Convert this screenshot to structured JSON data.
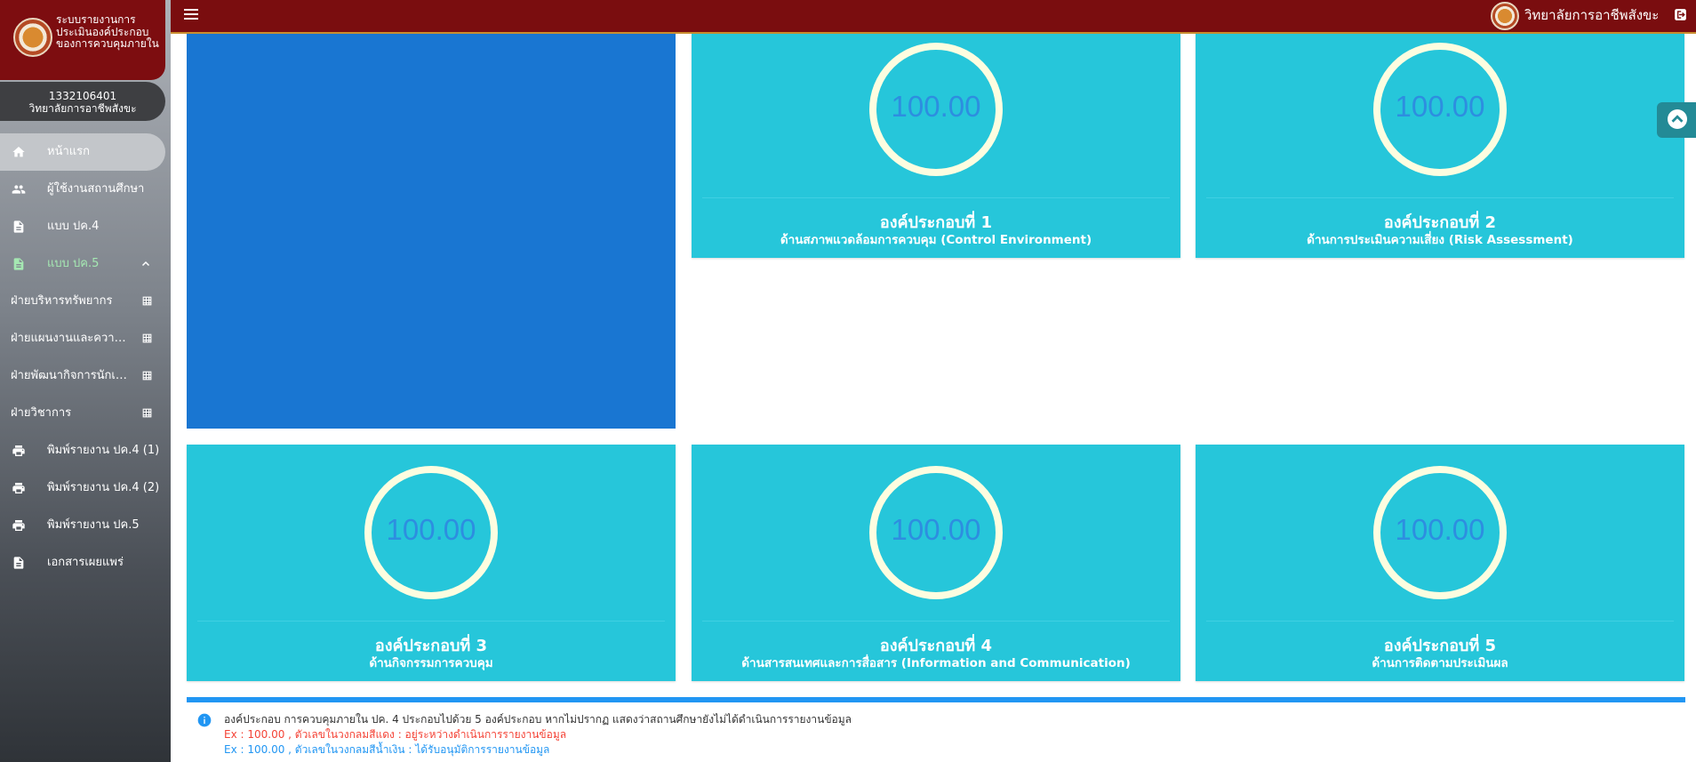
{
  "sidebar": {
    "brand_title": "ระบบรายงานการประเมินองค์ประกอบของการควบคุมภายใน",
    "school_code": "1332106401",
    "school_name": "วิทยาลัยการอาชีพสังขะ",
    "nav": [
      {
        "label": "หน้าแรก",
        "icon": "home-icon",
        "active": true
      },
      {
        "label": "ผู้ใช้งานสถานศึกษา",
        "icon": "users-icon"
      },
      {
        "label": "แบบ ปค.4",
        "icon": "document-icon"
      },
      {
        "label": "แบบ ปค.5",
        "icon": "document-icon",
        "open": true
      }
    ],
    "sub_items": [
      {
        "label": "ฝ่ายบริหารทรัพยากร"
      },
      {
        "label": "ฝ่ายแผนงานและความร่วมมือ"
      },
      {
        "label": "ฝ่ายพัฒนากิจการนักเรียนนักศึกษา"
      },
      {
        "label": "ฝ่ายวิชาการ"
      }
    ],
    "nav_bottom": [
      {
        "label": "พิมพ์รายงาน ปค.4 (1)",
        "icon": "printer-icon"
      },
      {
        "label": "พิมพ์รายงาน ปค.4 (2)",
        "icon": "printer-icon"
      },
      {
        "label": "พิมพ์รายงาน ปค.5",
        "icon": "printer-icon"
      },
      {
        "label": "เอกสารเผยแพร่",
        "icon": "document-icon"
      }
    ]
  },
  "topbar": {
    "school_name": "วิทยาลัยการอาชีพสังขะ"
  },
  "cards": [
    {
      "score": "100.00",
      "title": "องค์ประกอบที่ 1",
      "subtitle": "ด้านสภาพแวดล้อมการควบคุม (Control Environment)"
    },
    {
      "score": "100.00",
      "title": "องค์ประกอบที่ 2",
      "subtitle": "ด้านการประเมินความเสี่ยง (Risk Assessment)"
    },
    {
      "score": "100.00",
      "title": "องค์ประกอบที่ 3",
      "subtitle": "ด้านกิจกรรมการควบคุม"
    },
    {
      "score": "100.00",
      "title": "องค์ประกอบที่ 4",
      "subtitle": "ด้านสารสนเทศและการสื่อสาร (Information and Communication)"
    },
    {
      "score": "100.00",
      "title": "องค์ประกอบที่ 5",
      "subtitle": "ด้านการติดตามประเมินผล"
    }
  ],
  "info": {
    "line1": "องค์ประกอบ การควบคุมภายใน ปค. 4 ประกอบไปด้วย 5 องค์ประกอบ หากไม่ปรากฏ แสดงว่าสถานศึกษายังไม่ได้ดำเนินการรายงานข้อมูล",
    "line2": "Ex : 100.00 , ตัวเลขในวงกลมสีแดง : อยู่ระหว่างดำเนินการรายงานข้อมูล",
    "line3": "Ex : 100.00 , ตัวเลขในวงกลมสีน้ำเงิน : ได้รับอนุมัติการรายงานข้อมูล"
  },
  "colors": {
    "topbar": "#7a0d0f",
    "card": "#26c6da",
    "blue_panel": "#1976d2",
    "score_text": "#2d8ee0",
    "info_accent": "#2196f3"
  }
}
